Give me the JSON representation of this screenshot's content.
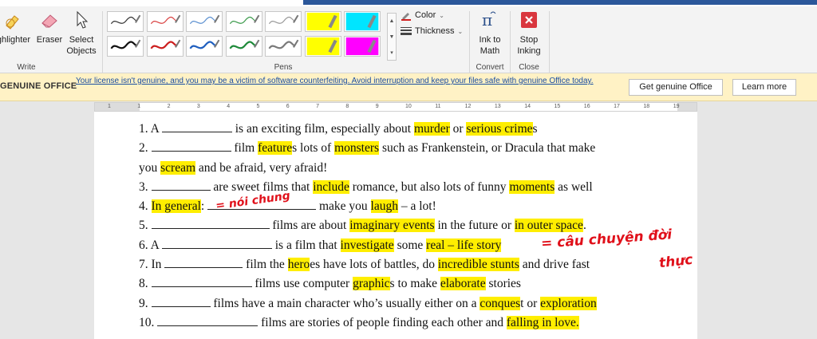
{
  "ribbon": {
    "write_group": {
      "label": "Write",
      "highlighter": "ghlighter",
      "eraser": "Eraser",
      "select_line1": "Select",
      "select_line2": "Objects"
    },
    "pens_group": {
      "label": "Pens"
    },
    "options": {
      "color": "Color",
      "thickness": "Thickness"
    },
    "convert_group": {
      "label": "Convert",
      "ink_line1": "Ink to",
      "ink_line2": "Math"
    },
    "close_group": {
      "label": "Close",
      "stop_line1": "Stop",
      "stop_line2": "Inking"
    }
  },
  "pens": [
    {
      "color": "#333333"
    },
    {
      "color": "#d94040"
    },
    {
      "color": "#5a8fd0"
    },
    {
      "color": "#3a9a4a"
    },
    {
      "color": "#999999"
    },
    {
      "color": "#ffff00",
      "highlighter": true
    },
    {
      "color": "#00e5ff",
      "highlighter": true
    },
    {
      "color": "#111111"
    },
    {
      "color": "#cc1f1f"
    },
    {
      "color": "#1f5fbf"
    },
    {
      "color": "#1f8a3a"
    },
    {
      "color": "#7a7a7a"
    },
    {
      "color": "#ffff00",
      "highlighter": true
    },
    {
      "color": "#ff00ff",
      "highlighter": true
    }
  ],
  "infobar": {
    "title": "GENUINE OFFICE",
    "message": "Your license isn't genuine, and you may be a victim of software counterfeiting. Avoid interruption and keep your files safe with genuine Office today.",
    "get_button": "Get genuine Office",
    "learn_button": "Learn more"
  },
  "ruler": [
    "1",
    "1",
    "2",
    "3",
    "4",
    "5",
    "6",
    "7",
    "8",
    "9",
    "10",
    "11",
    "12",
    "13",
    "14",
    "15",
    "16",
    "17",
    "18",
    "19"
  ],
  "document": {
    "l1_a": "1. A ",
    "l1_b": " is an exciting film, especially about ",
    "l1_hl1": "murder",
    "l1_c": " or ",
    "l1_hl2": "serious crime",
    "l1_d": "s",
    "l2_a": "2. ",
    "l2_b": " film ",
    "l2_hl1": "feature",
    "l2_c": "s lots of ",
    "l2_hl2": "monsters",
    "l2_d": " such as Frankenstein, or Dracula that make",
    "l3_a": "you ",
    "l3_hl1": "scream",
    "l3_b": " and be afraid, very afraid!",
    "l4_a": "3. ",
    "l4_b": " are sweet films that ",
    "l4_hl1": "include",
    "l4_c": " romance, but also lots of funny ",
    "l4_hl2": "moments",
    "l4_d": " as well",
    "l5_a": "4. ",
    "l5_hl1": "In general",
    "l5_b": ": ",
    "l5_c": " make you ",
    "l5_hl2": "laugh",
    "l5_d": " – a lot!",
    "l6_a": "5. ",
    "l6_b": " films are about ",
    "l6_hl1": "imaginary events",
    "l6_c": " in the future or ",
    "l6_hl2": "in outer space",
    "l6_d": ".",
    "l7_a": "6. A ",
    "l7_b": " is a film that ",
    "l7_hl1": "investigate",
    "l7_c": " some ",
    "l7_hl2": "real – life story",
    "l8_a": "7. In ",
    "l8_b": " film the ",
    "l8_hl1": "hero",
    "l8_c": "es have lots of battles, do ",
    "l8_hl2": "incredible stunts",
    "l8_d": " and drive fast",
    "l9_a": "8. ",
    "l9_b": " films use computer ",
    "l9_hl1": "graphic",
    "l9_c": "s to make ",
    "l9_hl2": "elaborate",
    "l9_d": " stories",
    "l10_a": "9. ",
    "l10_b": " films have a main character who’s usually either on a ",
    "l10_hl1": "conques",
    "l10_c": "t or ",
    "l10_hl2": "exploration",
    "l11_a": "10. ",
    "l11_b": " films are stories of people finding each other and ",
    "l11_hl1": "falling in love."
  },
  "handwriting": {
    "note1": "= nói chung",
    "note2": "= câu chuyện đời",
    "note3": "thực"
  }
}
